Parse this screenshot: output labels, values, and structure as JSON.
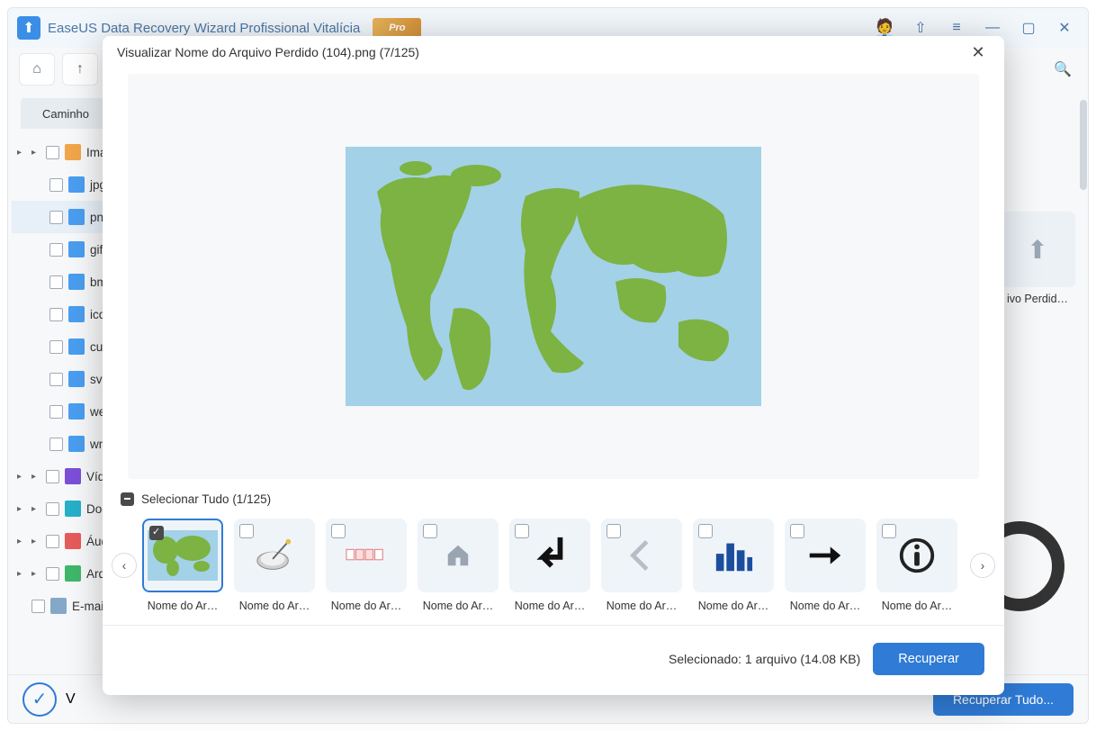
{
  "titlebar": {
    "title": "EaseUS Data Recovery Wizard Profissional Vitalícia",
    "pro_label": "Pro"
  },
  "sidebar": {
    "tab_label": "Caminho",
    "items": [
      {
        "label": "Imagens",
        "icon": "orange",
        "top": true
      },
      {
        "label": "jpg",
        "icon": "blue"
      },
      {
        "label": "png",
        "icon": "blue",
        "selected": true
      },
      {
        "label": "gif",
        "icon": "blue"
      },
      {
        "label": "bmp",
        "icon": "blue"
      },
      {
        "label": "ico",
        "icon": "blue"
      },
      {
        "label": "cur",
        "icon": "blue"
      },
      {
        "label": "svg",
        "icon": "blue"
      },
      {
        "label": "webp",
        "icon": "blue"
      },
      {
        "label": "wmf",
        "icon": "blue"
      },
      {
        "label": "Vídeos",
        "icon": "purple",
        "top": true
      },
      {
        "label": "Documentos",
        "icon": "cyan",
        "top": true
      },
      {
        "label": "Áudio",
        "icon": "red",
        "top": true
      },
      {
        "label": "Arquivos",
        "icon": "green",
        "top": true
      },
      {
        "label": "E-mails",
        "icon": "grayblue",
        "top": false,
        "noexpand": true
      }
    ]
  },
  "background_thumbs": [
    {
      "label": "ivo Perdid…"
    },
    {
      "label": "ivo Perdid…"
    }
  ],
  "bottom": {
    "recover_all": "Recuperar Tudo..."
  },
  "modal": {
    "title": "Visualizar Nome do Arquivo Perdido (104).png (7/125)",
    "select_all": "Selecionar Tudo (1/125)",
    "thumbs": [
      {
        "label": "Nome do Ar…",
        "checked": true,
        "selected": true,
        "kind": "world"
      },
      {
        "label": "Nome do Ar…",
        "kind": "dish"
      },
      {
        "label": "Nome do Ar…",
        "kind": "boxes"
      },
      {
        "label": "Nome do Ar…",
        "kind": "home"
      },
      {
        "label": "Nome do Ar…",
        "kind": "arrow-in"
      },
      {
        "label": "Nome do Ar…",
        "kind": "chevrons"
      },
      {
        "label": "Nome do Ar…",
        "kind": "bars"
      },
      {
        "label": "Nome do Ar…",
        "kind": "arrow-right"
      },
      {
        "label": "Nome do Ar…",
        "kind": "info"
      }
    ],
    "selected_info": "Selecionado: 1 arquivo (14.08 KB)",
    "recover": "Recuperar"
  }
}
